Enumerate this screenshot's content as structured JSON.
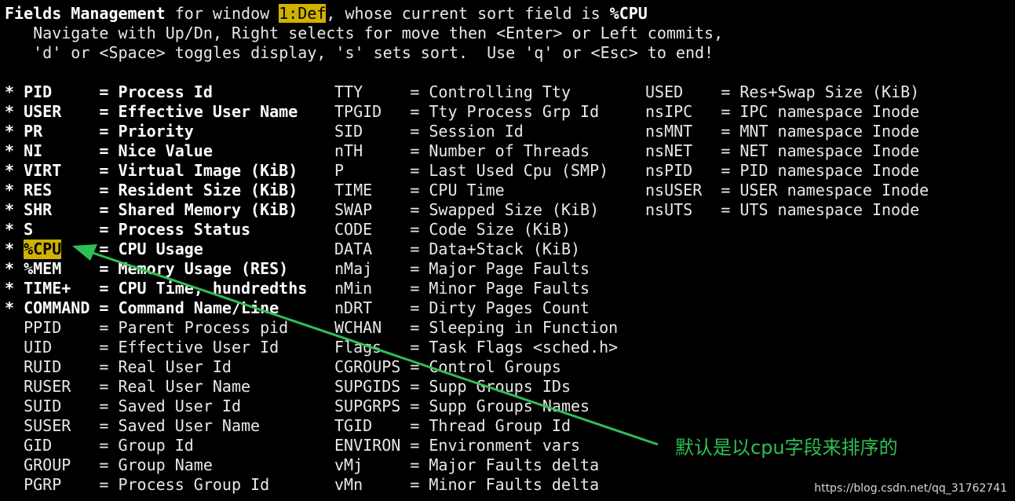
{
  "header": {
    "title_bold": "Fields Management",
    "title_mid": " for window ",
    "window_name": "1:Def",
    "title_rest": ", whose current sort field is ",
    "sort_field": "%CPU",
    "help_line1": "   Navigate with Up/Dn, Right selects for move then <Enter> or Left commits,",
    "help_line2": "   'd' or <Space> toggles display, 's' sets sort.  Use 'q' or <Esc> to end!"
  },
  "columns": [
    {
      "fields": [
        {
          "mark": "*",
          "name": "PID",
          "desc": "Process Id",
          "active": true
        },
        {
          "mark": "*",
          "name": "USER",
          "desc": "Effective User Name",
          "active": true
        },
        {
          "mark": "*",
          "name": "PR",
          "desc": "Priority",
          "active": true
        },
        {
          "mark": "*",
          "name": "NI",
          "desc": "Nice Value",
          "active": true
        },
        {
          "mark": "*",
          "name": "VIRT",
          "desc": "Virtual Image (KiB)",
          "active": true
        },
        {
          "mark": "*",
          "name": "RES",
          "desc": "Resident Size (KiB)",
          "active": true
        },
        {
          "mark": "*",
          "name": "SHR",
          "desc": "Shared Memory (KiB)",
          "active": true
        },
        {
          "mark": "*",
          "name": "S",
          "desc": "Process Status",
          "active": true
        },
        {
          "mark": "*",
          "name": "%CPU",
          "desc": "CPU Usage",
          "active": true,
          "selected": true
        },
        {
          "mark": "*",
          "name": "%MEM",
          "desc": "Memory Usage (RES)",
          "active": true
        },
        {
          "mark": "*",
          "name": "TIME+",
          "desc": "CPU Time, hundredths",
          "active": true
        },
        {
          "mark": "*",
          "name": "COMMAND",
          "desc": "Command Name/Line",
          "active": true
        },
        {
          "mark": " ",
          "name": "PPID",
          "desc": "Parent Process pid",
          "active": false
        },
        {
          "mark": " ",
          "name": "UID",
          "desc": "Effective User Id",
          "active": false
        },
        {
          "mark": " ",
          "name": "RUID",
          "desc": "Real User Id",
          "active": false
        },
        {
          "mark": " ",
          "name": "RUSER",
          "desc": "Real User Name",
          "active": false
        },
        {
          "mark": " ",
          "name": "SUID",
          "desc": "Saved User Id",
          "active": false
        },
        {
          "mark": " ",
          "name": "SUSER",
          "desc": "Saved User Name",
          "active": false
        },
        {
          "mark": " ",
          "name": "GID",
          "desc": "Group Id",
          "active": false
        },
        {
          "mark": " ",
          "name": "GROUP",
          "desc": "Group Name",
          "active": false
        },
        {
          "mark": " ",
          "name": "PGRP",
          "desc": "Process Group Id",
          "active": false
        }
      ]
    },
    {
      "fields": [
        {
          "name": "TTY",
          "desc": "Controlling Tty"
        },
        {
          "name": "TPGID",
          "desc": "Tty Process Grp Id"
        },
        {
          "name": "SID",
          "desc": "Session Id"
        },
        {
          "name": "nTH",
          "desc": "Number of Threads"
        },
        {
          "name": "P",
          "desc": "Last Used Cpu (SMP)"
        },
        {
          "name": "TIME",
          "desc": "CPU Time"
        },
        {
          "name": "SWAP",
          "desc": "Swapped Size (KiB)"
        },
        {
          "name": "CODE",
          "desc": "Code Size (KiB)"
        },
        {
          "name": "DATA",
          "desc": "Data+Stack (KiB)"
        },
        {
          "name": "nMaj",
          "desc": "Major Page Faults"
        },
        {
          "name": "nMin",
          "desc": "Minor Page Faults"
        },
        {
          "name": "nDRT",
          "desc": "Dirty Pages Count"
        },
        {
          "name": "WCHAN",
          "desc": "Sleeping in Function"
        },
        {
          "name": "Flags",
          "desc": "Task Flags <sched.h>"
        },
        {
          "name": "CGROUPS",
          "desc": "Control Groups"
        },
        {
          "name": "SUPGIDS",
          "desc": "Supp Groups IDs"
        },
        {
          "name": "SUPGRPS",
          "desc": "Supp Groups Names"
        },
        {
          "name": "TGID",
          "desc": "Thread Group Id"
        },
        {
          "name": "ENVIRON",
          "desc": "Environment vars"
        },
        {
          "name": "vMj",
          "desc": "Major Faults delta"
        },
        {
          "name": "vMn",
          "desc": "Minor Faults delta"
        }
      ]
    },
    {
      "fields": [
        {
          "name": "USED",
          "desc": "Res+Swap Size (KiB)"
        },
        {
          "name": "nsIPC",
          "desc": "IPC namespace Inode"
        },
        {
          "name": "nsMNT",
          "desc": "MNT namespace Inode"
        },
        {
          "name": "nsNET",
          "desc": "NET namespace Inode"
        },
        {
          "name": "nsPID",
          "desc": "PID namespace Inode"
        },
        {
          "name": "nsUSER",
          "desc": "USER namespace Inode"
        },
        {
          "name": "nsUTS",
          "desc": "UTS namespace Inode"
        }
      ]
    }
  ],
  "separator": "=",
  "annotation": {
    "text": "默认是以cpu字段来排序的",
    "color": "#2fbf55"
  },
  "watermark": "https://blog.csdn.net/qq_31762741",
  "colors": {
    "background": "#000000",
    "highlight": "#cfb100",
    "text": "#e8e8e8"
  }
}
